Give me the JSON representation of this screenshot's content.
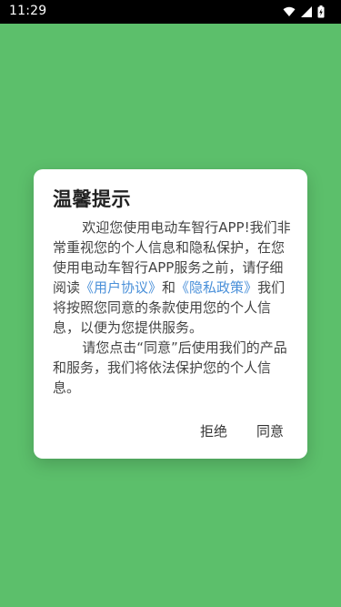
{
  "status_bar": {
    "time": "11:29",
    "icons": [
      "wifi-icon",
      "signal-icon",
      "battery-charging-icon"
    ]
  },
  "dialog": {
    "title": "温馨提示",
    "paragraph1": {
      "before_links": "欢迎您使用电动车智行APP!我们非常重视您的个人信息和隐私保护，在您使用电动车智行APP服务之前，请仔细阅读",
      "user_agreement_link": "《用户协议》",
      "and_text": "和",
      "privacy_policy_link": "《隐私政策》",
      "after_links": "我们将按照您同意的条款使用您的个人信息，以便为您提供服务。"
    },
    "paragraph2": "请您点击“同意”后使用我们的产品和服务，我们将依法保护您的个人信息。",
    "buttons": {
      "reject": "拒绝",
      "agree": "同意"
    }
  },
  "colors": {
    "background": "#5cbf6b",
    "status_bar": "#000000",
    "dialog": "#ffffff",
    "link": "#4a90d9"
  }
}
